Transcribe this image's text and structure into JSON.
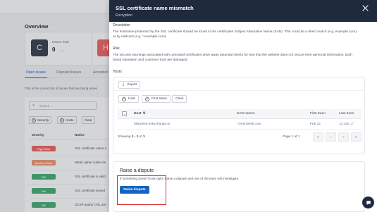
{
  "background": {
    "overview_title": "Overview",
    "card": {
      "grade": "C",
      "issues_label": "Issues Total",
      "issues_total": "0",
      "issues_sub": "- 0",
      "second_grade": "H"
    },
    "tabs": [
      {
        "label": "Open issues"
      },
      {
        "label": "Disputed issues"
      },
      {
        "label": "Accepted"
      }
    ],
    "description": "This is the current list of issues that are being asses",
    "search_placeholder": "Search...",
    "filters": {
      "severity": "Severity",
      "hosts": "Hosts",
      "clear": "Clear"
    },
    "table_headers": {
      "severity": "Severity",
      "notice": "Notice"
    },
    "rows": [
      {
        "severity": "High Risk",
        "notice": "SSL certificate name n",
        "color": "#ef6b6b"
      },
      {
        "severity": "Medium Risk",
        "notice": "Weak cipher suites de",
        "color": "#f29c7c"
      },
      {
        "severity": "OK",
        "notice": "SSL certificate is valid",
        "color": "#4caf7c"
      },
      {
        "severity": "OK",
        "notice": "SSL certificate issued",
        "color": "#4caf7c"
      },
      {
        "severity": "OK",
        "notice": "OCSP and/or CRL are",
        "color": "#4caf7c"
      }
    ]
  },
  "drawer": {
    "title": "SSL certificate name mismatch",
    "subtitle": "Encryption",
    "description_label": "Description",
    "description_text": "The hostname protected by the SSL certificate should be found in the certificates Subject Alternative Name (SAN). This could be a direct match (e.g. example.com) or by wildcard (e.g. *.example.com).",
    "risk_label": "Risk",
    "risk_text": "The security warnings associated with untrusted certificates drive away potential clients for fear that the website does not secure their personal information. Both brand reputation and customer trust are damaged.",
    "hosts_label": "Hosts",
    "export_label": "Export",
    "filter_host": "Host",
    "filter_first_seen": "First Seen",
    "clear_label": "Clear",
    "table": {
      "headers": {
        "host": "Host",
        "san_names": "SAN names",
        "first_seen": "First Seen",
        "last_seen": "Last Seen"
      },
      "rows": [
        {
          "host": "helpdesk.riskxchange.io",
          "san_names": "*.freshdesk.com",
          "first_seen": "Feb 22",
          "last_seen": "13 Jan. 2’"
        }
      ]
    },
    "pagination": {
      "showing_prefix": "Showing ",
      "showing_range": "1 - 1",
      "showing_of": " of ",
      "showing_total": "1",
      "page_text": "Page 1 of 1"
    },
    "dispute": {
      "title": "Raise a dispute",
      "text": "If something doesn't look right, Raise a dispute and one of the team will investigate.",
      "button_label": "Raise dispute"
    }
  },
  "icons": {
    "close": "close-icon",
    "export": "export-icon",
    "chat": "chat-icon",
    "search": "search-icon"
  },
  "colors": {
    "drawer_header": "#1f2a3d",
    "primary_button": "#1565c0",
    "highlight": "#d32f2f",
    "active_tab": "#2563eb"
  }
}
